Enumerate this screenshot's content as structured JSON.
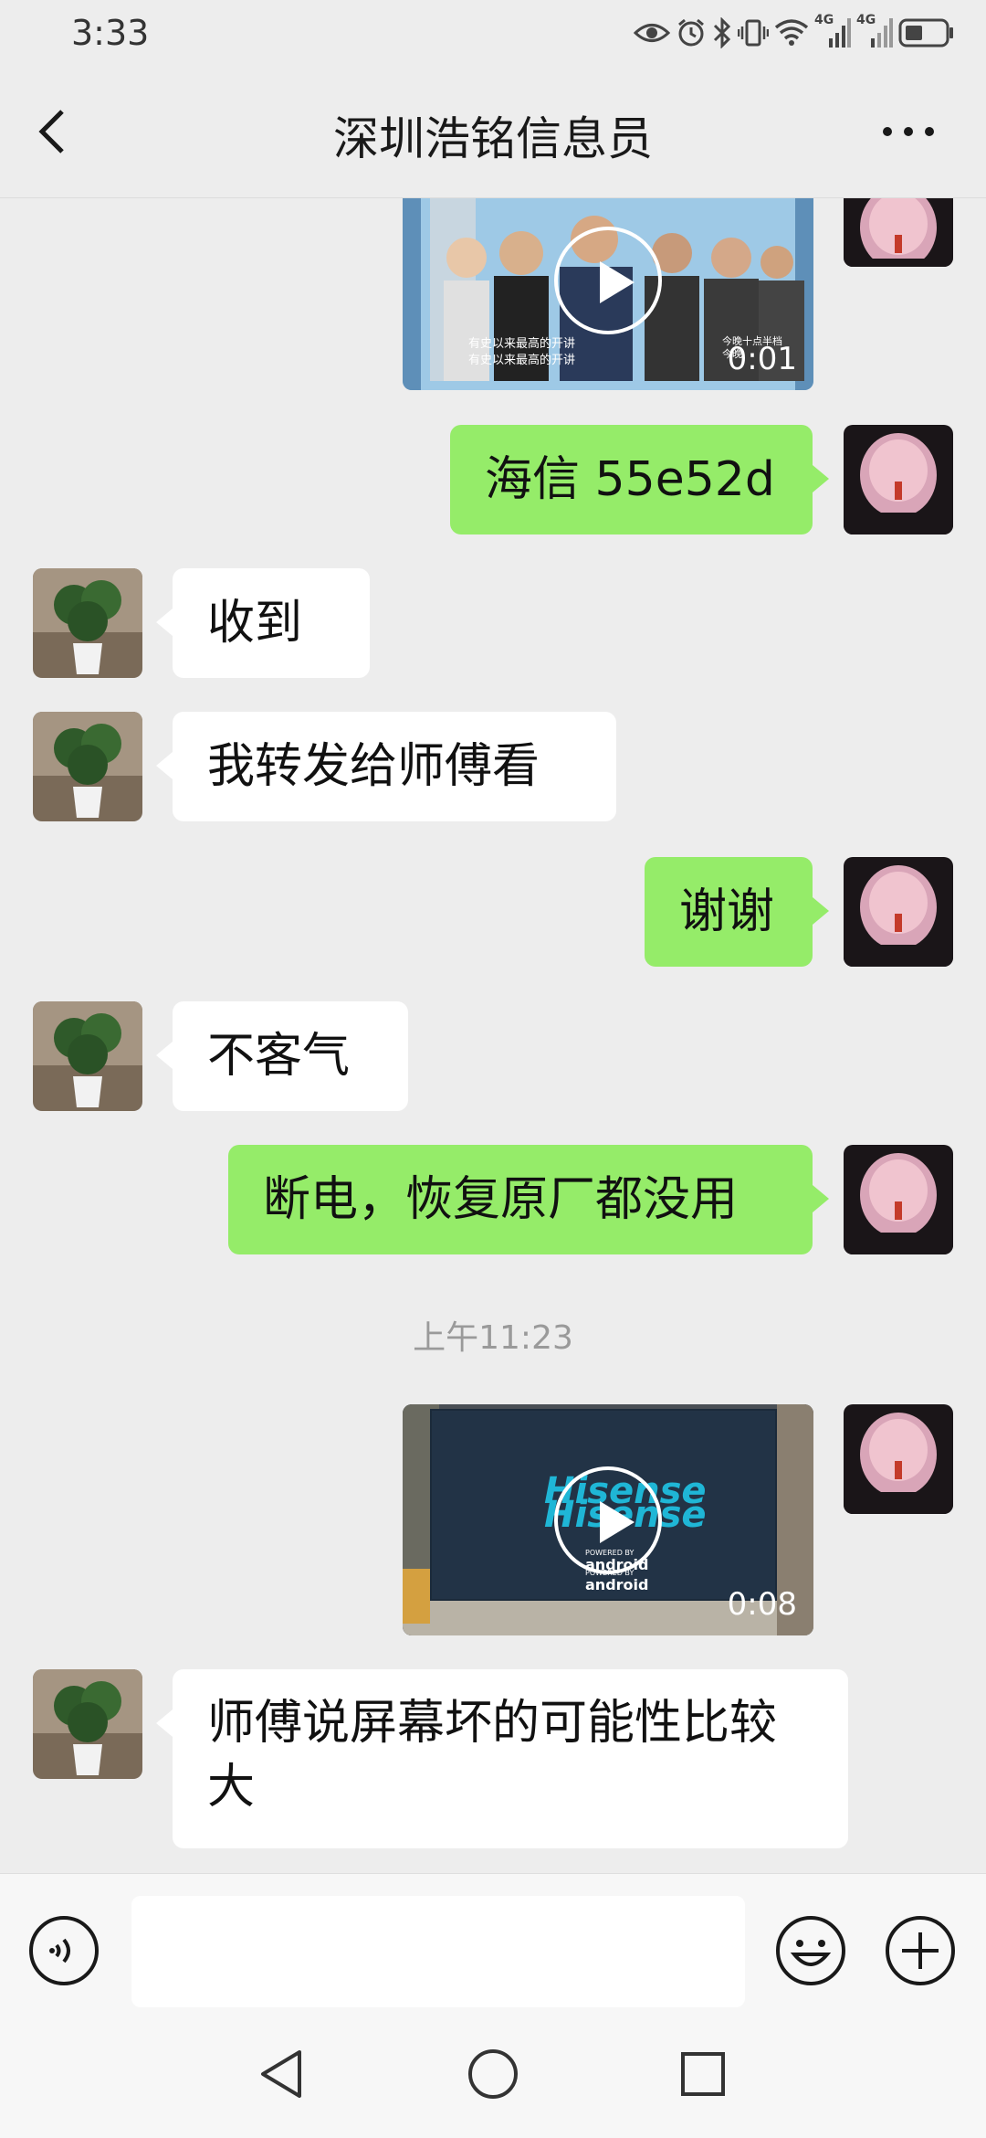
{
  "status_bar": {
    "time": "3:33",
    "network_1": "4G",
    "network_2": "4G"
  },
  "header": {
    "title": "深圳浩铭信息员"
  },
  "messages": [
    {
      "type": "video",
      "side": "right",
      "duration": "0:01",
      "caption_1": "有史以来最高的开讲",
      "caption_2": "有史以来最高的开讲",
      "caption_top_right": "今晚十点半档",
      "caption_top_right_2": "今晚"
    },
    {
      "type": "text",
      "side": "right",
      "text": "海信 55e52d"
    },
    {
      "type": "text",
      "side": "left",
      "text": "收到"
    },
    {
      "type": "text",
      "side": "left",
      "text": "我转发给师傅看"
    },
    {
      "type": "text",
      "side": "right",
      "text": "谢谢"
    },
    {
      "type": "text",
      "side": "left",
      "text": "不客气"
    },
    {
      "type": "text",
      "side": "right",
      "text": "断电，恢复原厂都没用"
    },
    {
      "type": "time",
      "text": "上午11:23"
    },
    {
      "type": "video",
      "side": "right",
      "duration": "0:08",
      "brand_1": "Hisense",
      "brand_2": "Hisense",
      "powered_1": "POWERED BY",
      "android_1": "android",
      "powered_2": "POWERED BY",
      "android_2": "android"
    },
    {
      "type": "text",
      "side": "left",
      "text_line_1": "师傅说屏幕坏的可能性比较",
      "text_line_2": "大"
    }
  ],
  "input_bar": {
    "value": "",
    "placeholder": ""
  },
  "colors": {
    "background": "#ededed",
    "sent_bubble": "#95ec69",
    "received_bubble": "#ffffff"
  },
  "icons": [
    "back-arrow-icon",
    "more-dots-icon",
    "voice-icon",
    "emoji-icon",
    "plus-icon",
    "nav-back-icon",
    "nav-home-icon",
    "nav-recents-icon",
    "eye-icon",
    "alarm-icon",
    "bluetooth-icon",
    "vibrate-icon",
    "wifi-icon",
    "signal-icon",
    "battery-icon"
  ]
}
